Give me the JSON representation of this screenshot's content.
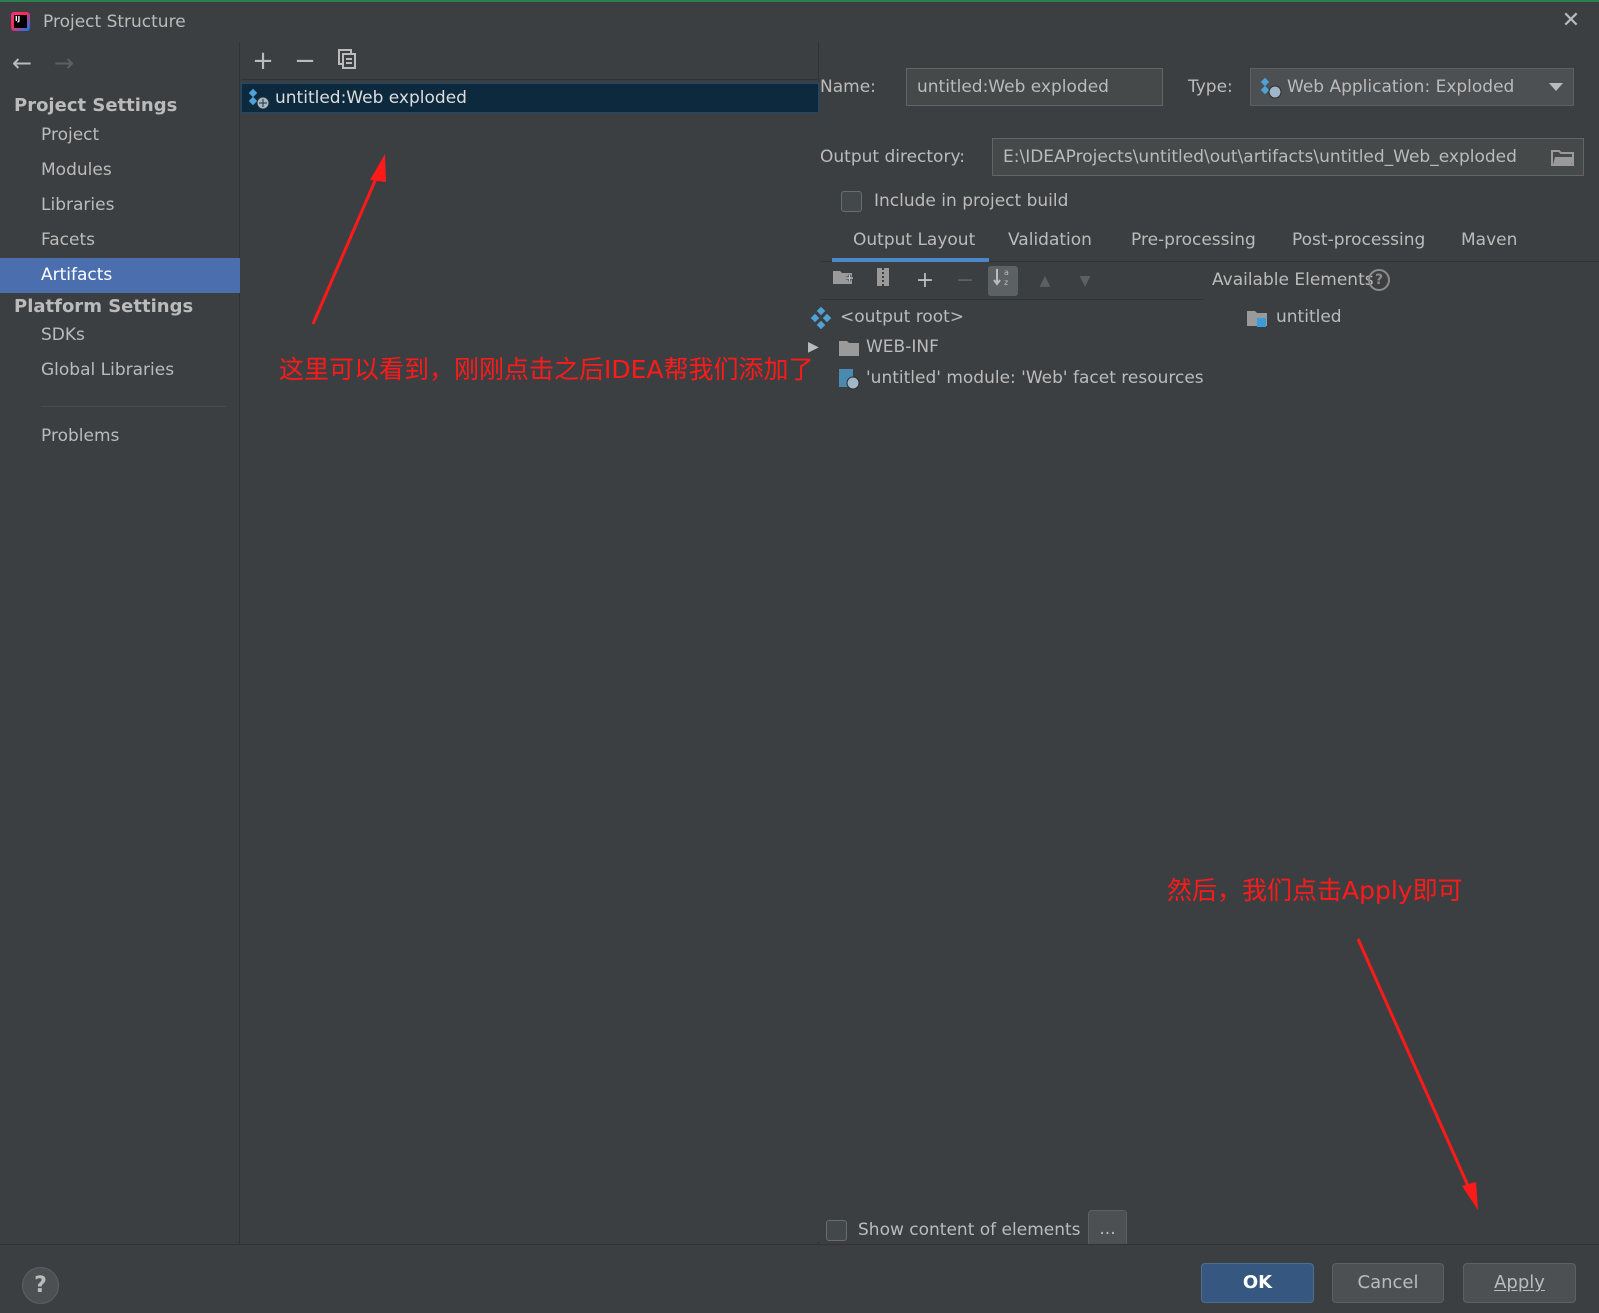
{
  "window": {
    "title": "Project Structure"
  },
  "sidebar": {
    "project_settings": "Project Settings",
    "items_project": [
      {
        "label": "Project"
      },
      {
        "label": "Modules"
      },
      {
        "label": "Libraries"
      },
      {
        "label": "Facets"
      },
      {
        "label": "Artifacts",
        "selected": true
      }
    ],
    "platform_settings": "Platform Settings",
    "items_platform": [
      {
        "label": "SDKs"
      },
      {
        "label": "Global Libraries"
      }
    ],
    "problems": "Problems"
  },
  "artifacts": {
    "items": [
      {
        "label": "untitled:Web exploded",
        "selected": true
      }
    ]
  },
  "details": {
    "name_label": "Name:",
    "name_value": "untitled:Web exploded",
    "type_label": "Type:",
    "type_value": "Web Application: Exploded",
    "output_dir_label": "Output directory:",
    "output_dir_value": "E:\\IDEAProjects\\untitled\\out\\artifacts\\untitled_Web_exploded",
    "include_build_label": "Include in project build",
    "include_build_checked": false,
    "tabs": [
      {
        "label": "Output Layout",
        "active": true
      },
      {
        "label": "Validation"
      },
      {
        "label": "Pre-processing"
      },
      {
        "label": "Post-processing"
      },
      {
        "label": "Maven"
      }
    ],
    "layout_tree": [
      {
        "label": "<output root>"
      },
      {
        "label": "WEB-INF"
      },
      {
        "label": "'untitled' module: 'Web' facet resources"
      }
    ],
    "available_title": "Available Elements",
    "available_items": [
      {
        "label": "untitled"
      }
    ],
    "show_content_label": "Show content of elements",
    "show_content_checked": false,
    "ellipsis_label": "..."
  },
  "footer": {
    "help": "?",
    "ok": "OK",
    "cancel": "Cancel",
    "apply": "Apply"
  },
  "annotations": {
    "note1": "这里可以看到，刚刚点击之后IDEA帮我们添加了",
    "note2": "然后，我们点击Apply即可",
    "color": "#ff1a1a"
  },
  "colors": {
    "background": "#3c3f41",
    "selection": "#4b6eaf",
    "list_selection": "#0d293e",
    "primary_button": "#365880",
    "tab_underline": "#4a88c7"
  }
}
